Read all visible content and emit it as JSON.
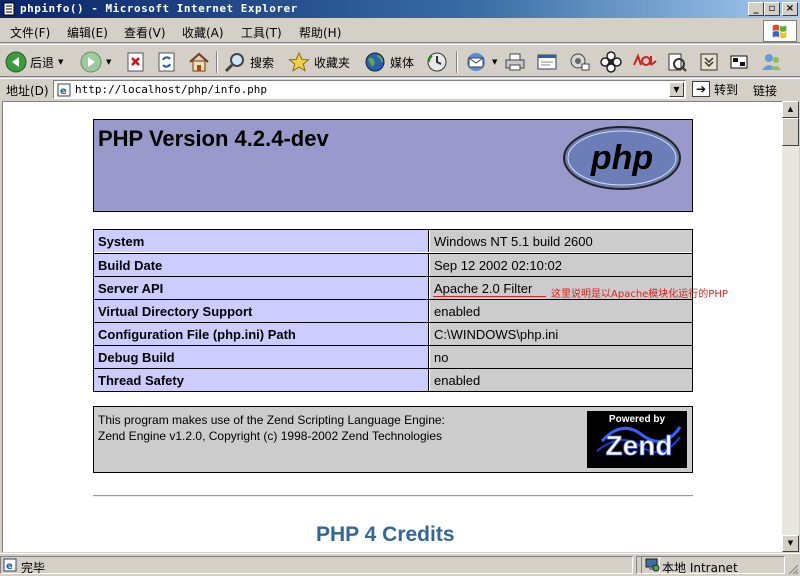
{
  "window": {
    "title": "phpinfo() - Microsoft Internet Explorer",
    "controls": [
      "_",
      "▫",
      "×"
    ]
  },
  "menu": [
    "文件(F)",
    "编辑(E)",
    "查看(V)",
    "收藏(A)",
    "工具(T)",
    "帮助(H)"
  ],
  "toolbar": {
    "back": "后退",
    "search": "搜索",
    "favorites": "收藏夹",
    "media": "媒体"
  },
  "address": {
    "label": "地址(D)",
    "url": "http://localhost/php/info.php",
    "go": "转到",
    "links": "链接"
  },
  "page": {
    "version": "PHP Version 4.2.4-dev",
    "info_rows": [
      {
        "key": "System",
        "value": "Windows NT 5.1 build 2600"
      },
      {
        "key": "Build Date",
        "value": "Sep 12 2002 02:10:02"
      },
      {
        "key": "Server API",
        "value": "Apache 2.0 Filter"
      },
      {
        "key": "Virtual Directory Support",
        "value": "enabled"
      },
      {
        "key": "Configuration File (php.ini) Path",
        "value": "C:\\WINDOWS\\php.ini"
      },
      {
        "key": "Debug Build",
        "value": "no"
      },
      {
        "key": "Thread Safety",
        "value": "enabled"
      }
    ],
    "annotation": "这里说明是以Apache模块化运行的PHP",
    "zend_line1": "This program makes use of the Zend Scripting Language Engine:",
    "zend_line2": "Zend Engine v1.2.0, Copyright (c) 1998-2002 Zend Technologies",
    "zend_logo_top": "Powered by",
    "zend_logo_word": "Zend",
    "php_logo_word": "php",
    "credits": "PHP 4 Credits"
  },
  "status": {
    "text": "完毕",
    "zone": "本地 Intranet"
  },
  "colors": {
    "header": "#9999cc",
    "key_cell": "#ccccff",
    "value_cell": "#cccccc",
    "annotation": "#e02020",
    "credits": "#336699"
  }
}
